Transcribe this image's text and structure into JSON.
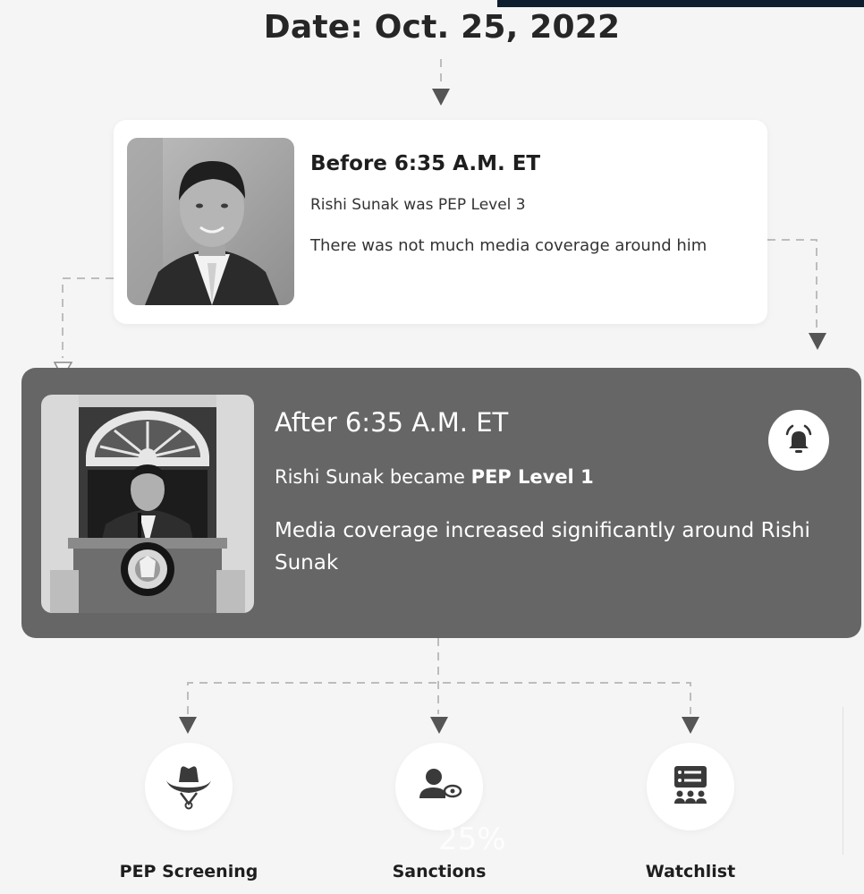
{
  "header": {
    "date_title": "Date: Oct. 25, 2022"
  },
  "before": {
    "title": "Before 6:35 A.M. ET",
    "line1": "Rishi Sunak was PEP Level 3",
    "line2": "There was not much media coverage around him"
  },
  "after": {
    "title": "After 6:35 A.M. ET",
    "line1_prefix": "Rishi Sunak became ",
    "line1_bold": "PEP Level 1",
    "line2": "Media coverage increased significantly around Rishi Sunak",
    "alert_icon": "bell-icon"
  },
  "outcomes": [
    {
      "label": "PEP Screening",
      "icon": "cowboy-hat-icon"
    },
    {
      "label": "Sanctions",
      "icon": "person-eye-icon"
    },
    {
      "label": "Watchlist",
      "icon": "watchlist-icon"
    }
  ],
  "overlay": {
    "ghost_text": "25%"
  },
  "colors": {
    "background": "#f5f5f5",
    "highlight_card": "#666666",
    "card": "#ffffff",
    "connector": "#bdbdbd",
    "arrow": "#555555"
  }
}
